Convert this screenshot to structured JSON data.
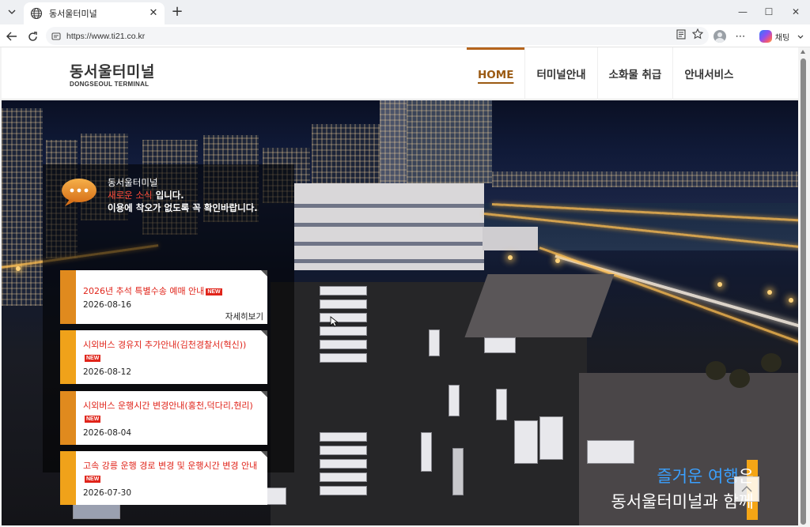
{
  "browser": {
    "tab_title": "동서울터미널",
    "url": "https://www.ti21.co.kr",
    "copilot_label": "채팅"
  },
  "site": {
    "logo_ko": "동서울터미널",
    "logo_en": "DONGSEOUL TERMINAL",
    "nav": [
      "HOME",
      "터미널안내",
      "소화물 취급",
      "안내서비스"
    ]
  },
  "notice": {
    "line1": "동서울터미널",
    "line2_highlight": "새로운 소식",
    "line2_rest": " 입니다.",
    "line3": "이용에 착오가 없도록 꼭 확인바랍니다.",
    "new_badge": "NEW",
    "more_label": "자세히보기",
    "items": [
      {
        "title": "2026년 추석 특별수송 예매 안내",
        "date": "2026-08-16"
      },
      {
        "title": "시외버스 경유지 추가안내(김천경찰서(혁신))",
        "date": "2026-08-12"
      },
      {
        "title": "시외버스 운행시간 변경안내(홍천,덕다리,현리)",
        "date": "2026-08-04"
      },
      {
        "title": "고속 강릉 운행 경로 변경 및 운행시간 변경 안내",
        "date": "2026-07-30"
      }
    ]
  },
  "hero": {
    "slogan_accent": "즐거운 여행",
    "slogan_rest": "은",
    "slogan_line2": "동서울터미널과 함께"
  },
  "colors": {
    "brand_orange": "#e08a1e",
    "accent_red": "#e0241a",
    "slogan_blue": "#3aa0ff"
  }
}
